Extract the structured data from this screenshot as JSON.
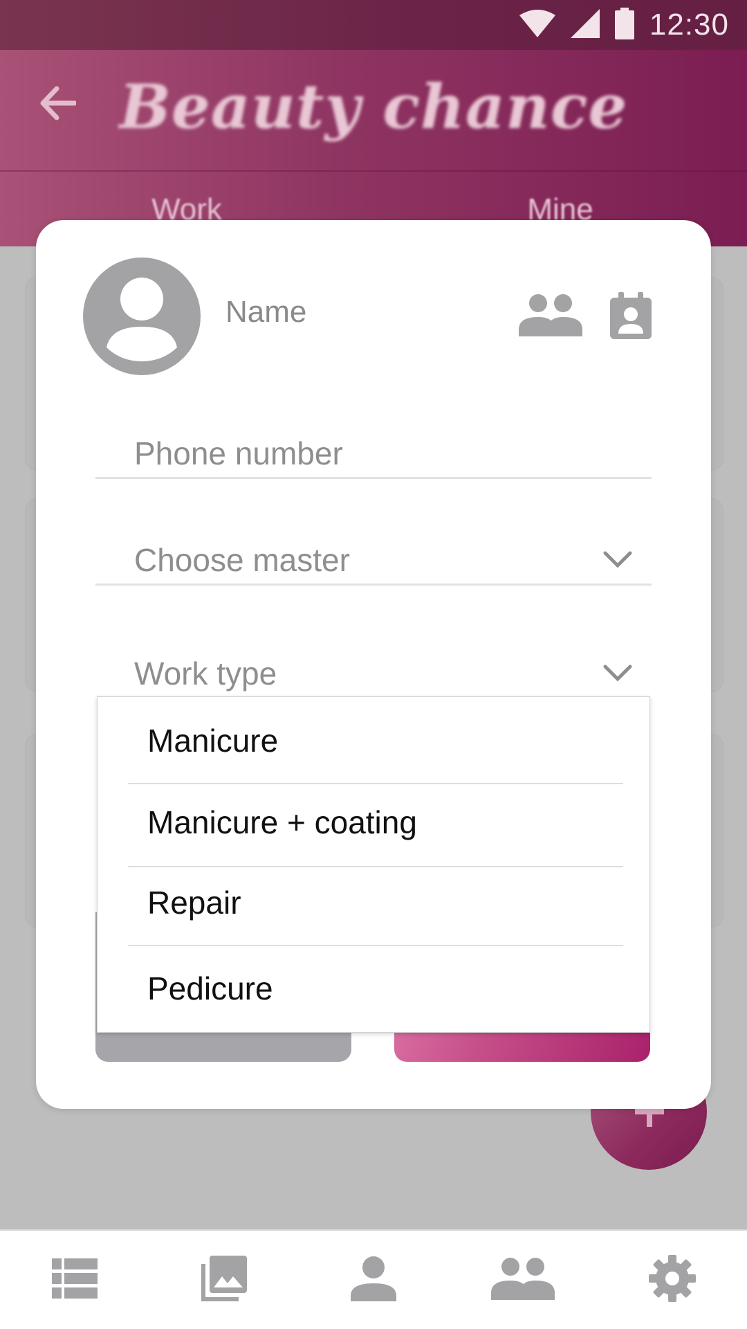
{
  "status_bar": {
    "time": "12:30",
    "icons": [
      "wifi-icon",
      "signal-icon",
      "battery-icon"
    ]
  },
  "app_bar": {
    "title": "Beauty chance",
    "back_icon": "arrow-back-icon",
    "tabs": [
      {
        "label": "Work"
      },
      {
        "label": "Mine"
      }
    ],
    "colors": {
      "start": "#a95176",
      "end": "#7b1d52"
    }
  },
  "dialog": {
    "name_label": "Name",
    "icons": [
      "account-circle-icon",
      "group-icon",
      "contact-calendar-icon"
    ],
    "phone_placeholder": "Phone number",
    "master_placeholder": "Choose master",
    "work_type_placeholder": "Work type",
    "button_colors": {
      "close": "#a6a6aa",
      "enter": "#c54d88"
    }
  },
  "dropdown": {
    "items": [
      {
        "label": "Manicure"
      },
      {
        "label": "Manicure + coating"
      },
      {
        "label": "Repair"
      },
      {
        "label": "Pedicure"
      }
    ]
  },
  "fab": {
    "icon": "plus-icon"
  },
  "bottom_nav": {
    "items": [
      {
        "icon": "list-icon"
      },
      {
        "icon": "gallery-icon"
      },
      {
        "icon": "person-icon"
      },
      {
        "icon": "group-icon"
      },
      {
        "icon": "settings-icon"
      }
    ]
  }
}
